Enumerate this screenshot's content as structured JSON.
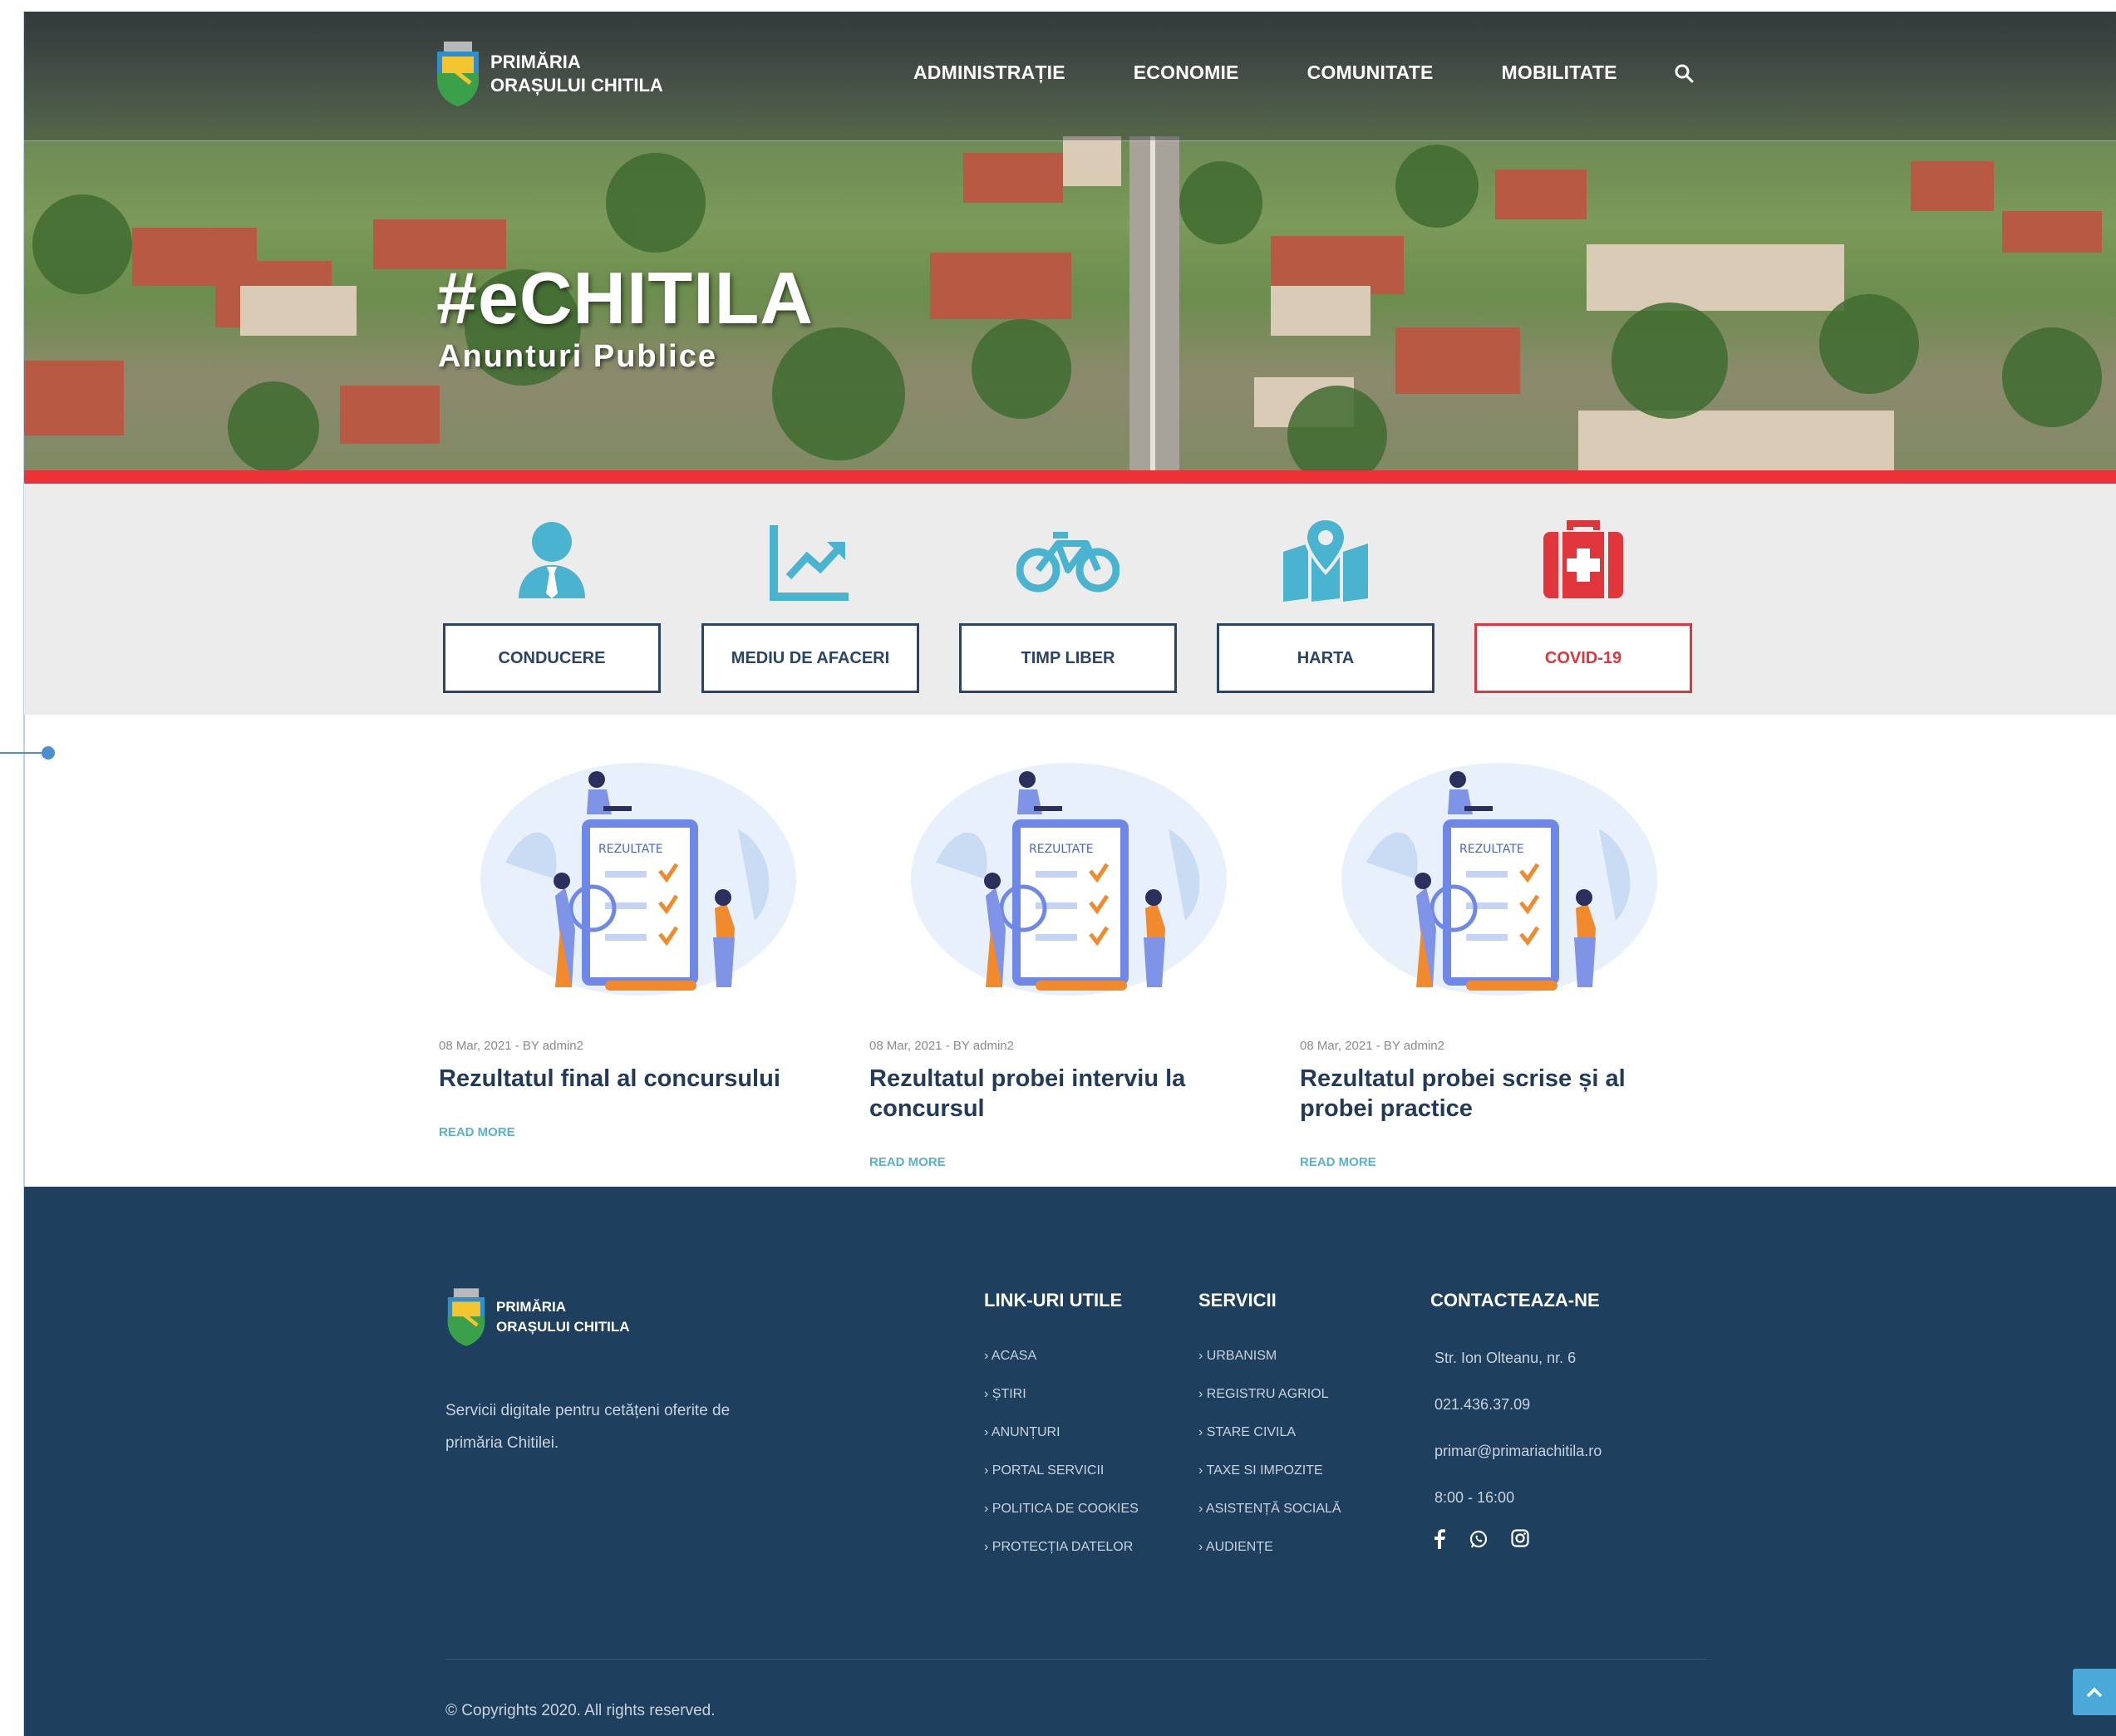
{
  "header": {
    "logo_line1": "PRIMĂRIA",
    "logo_line2": "ORAȘULUI CHITILA",
    "nav": [
      "ADMINISTRAȚIE",
      "ECONOMIE",
      "COMUNITATE",
      "MOBILITATE"
    ]
  },
  "hero": {
    "title": "#eCHITILA",
    "subtitle": "Anunturi Publice"
  },
  "quick_links": [
    {
      "label": "CONDUCERE",
      "icon": "person-tie-icon"
    },
    {
      "label": "MEDIU DE AFACERI",
      "icon": "chart-line-icon"
    },
    {
      "label": "TIMP LIBER",
      "icon": "bicycle-icon"
    },
    {
      "label": "HARTA",
      "icon": "map-pin-icon"
    },
    {
      "label": "COVID-19",
      "icon": "first-aid-icon"
    }
  ],
  "news": [
    {
      "meta": "08 Mar, 2021 - BY admin2",
      "title": "Rezultatul final al concursului",
      "more": "READ MORE"
    },
    {
      "meta": "08 Mar, 2021 - BY admin2",
      "title": "Rezultatul probei interviu la concursul",
      "more": "READ MORE"
    },
    {
      "meta": "08 Mar, 2021 - BY admin2",
      "title": "Rezultatul probei scrise și al probei practice",
      "more": "READ MORE"
    }
  ],
  "illustration_label": "REZULTATE",
  "footer": {
    "logo_line1": "PRIMĂRIA",
    "logo_line2": "ORAȘULUI CHITILA",
    "description": "Servicii digitale pentru cetățeni oferite de primăria Chitilei.",
    "links_heading": "LINK-URI UTILE",
    "links": [
      "ACASA",
      "ȘTIRI",
      "ANUNȚURI",
      "PORTAL SERVICII",
      "POLITICA DE COOKIES",
      "PROTECȚIA DATELOR"
    ],
    "services_heading": "SERVICII",
    "services": [
      "URBANISM",
      "REGISTRU AGRIOL",
      "STARE CIVILA",
      "TAXE SI IMPOZITE",
      "ASISTENȚĂ SOCIALĂ",
      "AUDIENȚE"
    ],
    "contact_heading": "CONTACTEAZA-NE",
    "address": "Str. Ion Olteanu, nr. 6",
    "phone": "021.436.37.09",
    "email": "primar@primariachitila.ro",
    "hours": "8:00 - 16:00",
    "copyright": "© Copyrights 2020. All rights reserved."
  },
  "colors": {
    "accent_red": "#ed3237",
    "navy": "#1e3f5e",
    "teal_icon": "#4ab3cf",
    "link_blue": "#56b2cf"
  }
}
